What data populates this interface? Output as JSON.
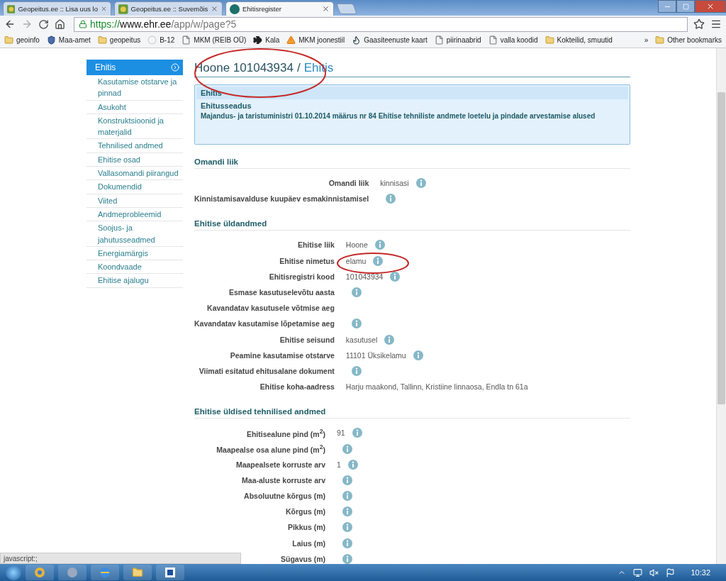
{
  "browser": {
    "tabs": [
      {
        "title": "Geopeitus.ee :: Lisa uus lo",
        "kind": "geo",
        "selected": false
      },
      {
        "title": "Geopeitus.ee :: Suvemõis",
        "kind": "geo",
        "selected": false
      },
      {
        "title": "Ehitisregister",
        "kind": "ehr",
        "selected": true
      }
    ],
    "address": {
      "scheme": "https://",
      "host": "www.ehr.ee",
      "path": "/app/w/page?5"
    },
    "bookmarks": [
      {
        "label": "geoinfo",
        "kind": "folder"
      },
      {
        "label": "Maa-amet",
        "kind": "shield"
      },
      {
        "label": "geopeitus",
        "kind": "folder"
      },
      {
        "label": "B-12",
        "kind": "dot"
      },
      {
        "label": "MKM  (REIB OÜ)",
        "kind": "page"
      },
      {
        "label": "Kala",
        "kind": "fish"
      },
      {
        "label": "MKM joonestiil",
        "kind": "warning"
      },
      {
        "label": "Gaasiteenuste kaart",
        "kind": "flame"
      },
      {
        "label": "piirinaabrid",
        "kind": "page"
      },
      {
        "label": "valla koodid",
        "kind": "page"
      },
      {
        "label": "Kokteilid, smuutid",
        "kind": "folder"
      }
    ],
    "overflow": "»",
    "other_bookmarks": "Other bookmarks",
    "status_text": "javascript:;"
  },
  "sidebar": {
    "header": "Ehitis",
    "items": [
      "Kasutamise otstarve ja pinnad",
      "Asukoht",
      "Konstruktsioonid ja materjalid",
      "Tehnilised andmed",
      "Ehitise osad",
      "Vallasomandi piirangud",
      "Dokumendid",
      "Viited",
      "Andmeprobleemid",
      "Soojus- ja jahutusseadmed",
      "Energiamärgis",
      "Koondvaade",
      "Ehitise ajalugu"
    ]
  },
  "heading": {
    "main": "Hoone 101043934",
    "separator": "/",
    "current": "Ehitis"
  },
  "info_box": {
    "title": "Ehitis",
    "subtitle": "Ehitusseadus",
    "text": "Majandus- ja taristuministri 01.10.2014 määrus nr 84 Ehitise tehniliste andmete loetelu ja pindade arvestamise alused"
  },
  "sections": [
    {
      "title": "Omandi liik",
      "rows": [
        {
          "label": "Omandi liik",
          "value": "kinnisasi",
          "info": true
        },
        {
          "label": "Kinnistamisavalduse kuupäev esmakinnistamisel",
          "info": true
        }
      ]
    },
    {
      "title": "Ehitise üldandmed",
      "rows": [
        {
          "label": "Ehitise liik",
          "value": "Hoone",
          "info": true
        },
        {
          "label": "Ehitise nimetus",
          "value": "elamu",
          "info": true
        },
        {
          "label": "Ehitisregistri kood",
          "value": "101043934",
          "info": true
        },
        {
          "label": "Esmase kasutuselevõtu aasta",
          "info": true
        },
        {
          "label": "Kavandatav kasutusele võtmise aeg",
          "info": false
        },
        {
          "label": "Kavandatav kasutamise lõpetamise aeg",
          "info": true
        },
        {
          "label": "Ehitise seisund",
          "value": "kasutusel",
          "info": true
        },
        {
          "label": "Peamine kasutamise otstarve",
          "value": "11101 Üksikelamu",
          "info": true
        },
        {
          "label": "Viimati esitatud ehitusalane dokument",
          "info": true
        },
        {
          "label": "Ehitise koha-aadress",
          "value": "Harju maakond, Tallinn, Kristiine linnaosa, Endla tn 61a",
          "info": false
        }
      ]
    },
    {
      "title": "Ehitise üldised tehnilised andmed",
      "rows": [
        {
          "label": "Ehitisealune pind (m$^{2}$)",
          "value": "91",
          "info": true
        },
        {
          "label": "Maapealse osa alune pind (m$^{2}$)",
          "info": true
        },
        {
          "label": "Maapealsete korruste arv",
          "value": "1",
          "info": true
        },
        {
          "label": "Maa-aluste korruste arv",
          "info": true
        },
        {
          "label": "Absoluutne kõrgus (m)",
          "info": true
        },
        {
          "label": "Kõrgus (m)",
          "info": true
        },
        {
          "label": "Pikkus (m)",
          "info": true
        },
        {
          "label": "Laius (m)",
          "info": true
        },
        {
          "label": "Sügavus (m)",
          "info": true
        }
      ]
    }
  ],
  "taskbar": {
    "clock": "10:32"
  }
}
